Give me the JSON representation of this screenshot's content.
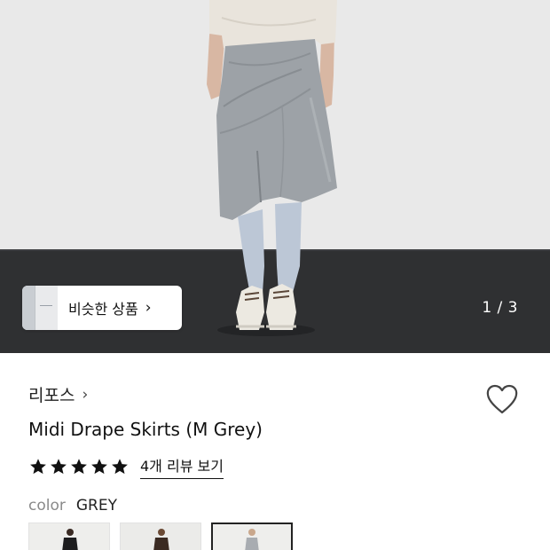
{
  "hero": {
    "similar_button_label": "비슷한 상품",
    "similar_button_chevron": "›",
    "page_indicator": "1 / 3"
  },
  "product": {
    "brand": "리포스",
    "brand_chevron": "›",
    "title": "Midi Drape Skirts (M Grey)",
    "rating": 5,
    "rating_max": 5,
    "review_link": "4개 리뷰 보기",
    "color_label": "color",
    "color_value": "GREY",
    "swatches": [
      {
        "name": "black",
        "selected": false
      },
      {
        "name": "brown",
        "selected": false
      },
      {
        "name": "grey",
        "selected": true
      }
    ]
  },
  "icons": {
    "like": "heart-outline-icon",
    "star": "star-filled-icon",
    "chevron": "chevron-right-icon"
  },
  "colors": {
    "wall": "#ececec",
    "floor": "#2f3032",
    "text": "#111111",
    "muted": "#8a8a8a",
    "selected_border": "#222222"
  }
}
